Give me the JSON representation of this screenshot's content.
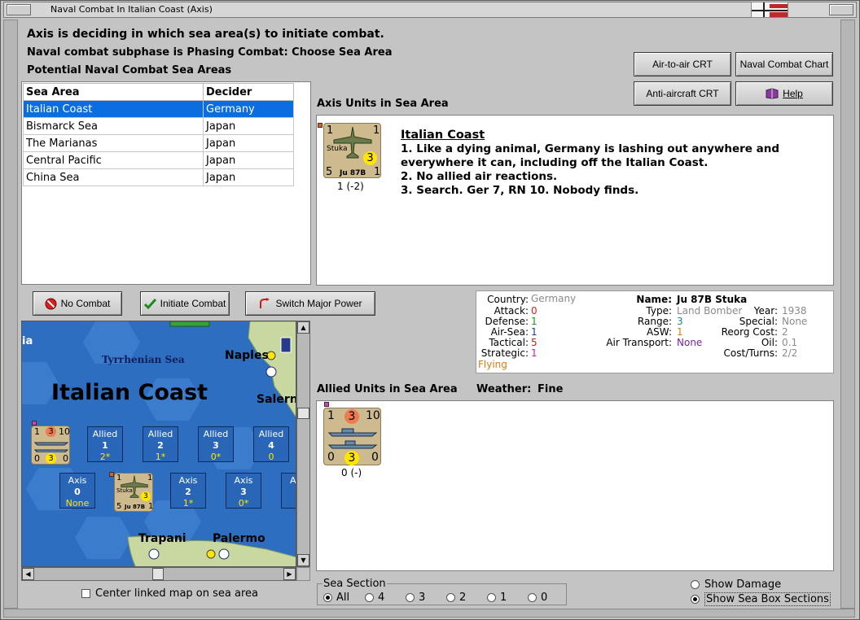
{
  "window": {
    "title": "Naval Combat In Italian Coast (Axis)"
  },
  "header": {
    "line1": "Axis is deciding in which sea area(s) to initiate combat.",
    "line2": "Naval combat subphase is Phasing Combat: Choose Sea Area",
    "line3": "Potential Naval Combat Sea Areas"
  },
  "table": {
    "columns": [
      "Sea Area",
      "Decider"
    ],
    "rows": [
      {
        "area": "Italian Coast",
        "decider": "Germany"
      },
      {
        "area": "Bismarck Sea",
        "decider": "Japan"
      },
      {
        "area": "The Marianas",
        "decider": "Japan"
      },
      {
        "area": "Central Pacific",
        "decider": "Japan"
      },
      {
        "area": "China Sea",
        "decider": "Japan"
      }
    ]
  },
  "buttons": {
    "air_to_air": "Air-to-air CRT",
    "naval_chart": "Naval Combat Chart",
    "anti_aircraft": "Anti-aircraft CRT",
    "help": "Help",
    "no_combat": "No Combat",
    "initiate": "Initiate Combat",
    "switch": "Switch Major Power"
  },
  "axis_panel": {
    "label": "Axis Units in Sea Area",
    "unit": {
      "name": "Stuka",
      "type": "Ju 87B",
      "top_left": "1",
      "top_right": "1",
      "left": "5",
      "right": "1",
      "circle": "3",
      "count": "1 (-2)"
    },
    "narrative": {
      "heading": "Italian Coast",
      "lines": [
        "1. Like a dying animal, Germany is lashing out anywhere and",
        "everywhere it can, including off the Italian Coast.",
        "2. No allied air reactions.",
        "3. Search. Ger 7, RN 10.  Nobody finds."
      ]
    }
  },
  "info": {
    "labels": {
      "country": "Country:",
      "attack": "Attack:",
      "defense": "Defense:",
      "air_sea": "Air-Sea:",
      "tactical": "Tactical:",
      "strategic": "Strategic:",
      "name": "Name:",
      "type": "Type:",
      "range": "Range:",
      "asw": "ASW:",
      "air_transport": "Air Transport:",
      "year": "Year:",
      "special": "Special:",
      "reorg": "Reorg Cost:",
      "oil": "Oil:",
      "cost": "Cost/Turns:"
    },
    "values": {
      "country": "Germany",
      "attack": "0",
      "defense": "1",
      "air_sea": "1",
      "tactical": "5",
      "strategic": "1",
      "status": "Flying",
      "name": "Ju 87B Stuka",
      "type": "Land Bomber",
      "range": "3",
      "asw": "1",
      "air_transport": "None",
      "year": "1938",
      "special": "None",
      "reorg": "2",
      "oil": "0.1",
      "cost": "2/2"
    }
  },
  "allied_panel": {
    "label": "Allied Units in Sea Area",
    "weather_label": "Weather:",
    "weather": "Fine",
    "unit": {
      "top_left": "1",
      "circle_top": "3",
      "top_right": "10",
      "left": "0",
      "circle_bottom": "3",
      "right": "0",
      "count": "0 (-)"
    }
  },
  "map": {
    "sea_name": "Tyrrhenian Sea",
    "area_name": "Italian Coast",
    "left_label": "ia",
    "cities": [
      "Naples",
      "Salern",
      "Trapani",
      "Palermo"
    ],
    "stack_counter": {
      "tl": "1",
      "tc": "3",
      "tr": "10",
      "bl": "0",
      "bc": "3",
      "br": "0"
    },
    "allied_boxes": [
      {
        "side": "Allied",
        "num": "1",
        "val": "2*"
      },
      {
        "side": "Allied",
        "num": "2",
        "val": "1*"
      },
      {
        "side": "Allied",
        "num": "3",
        "val": "0*"
      },
      {
        "side": "Allied",
        "num": "4",
        "val": "0"
      }
    ],
    "axis_boxes": [
      {
        "side": "Axis",
        "num": "0",
        "val": "None"
      },
      {
        "side": "Axis",
        "num": "2",
        "val": "1*"
      },
      {
        "side": "Axis",
        "num": "3",
        "val": "0*"
      },
      {
        "side": "A",
        "num": "",
        "val": ""
      }
    ],
    "axis_counter": {
      "name": "Stuka",
      "type": "Ju 87B",
      "tl": "1",
      "tr": "1",
      "bl": "5",
      "br": "1",
      "circle": "3"
    }
  },
  "center_linked": "Center linked map on sea area",
  "sea_section": {
    "label": "Sea Section",
    "options": [
      "All",
      "4",
      "3",
      "2",
      "1",
      "0"
    ],
    "selected": "All"
  },
  "display_options": {
    "show_damage": "Show Damage",
    "show_sections": "Show Sea Box Sections"
  },
  "colors": {
    "selection": "#0a6ee0",
    "sea": "#2e6ec0",
    "counter": "#cdbb8f",
    "circle_yellow": "#ffe600",
    "circle_orange": "#f07a50"
  }
}
